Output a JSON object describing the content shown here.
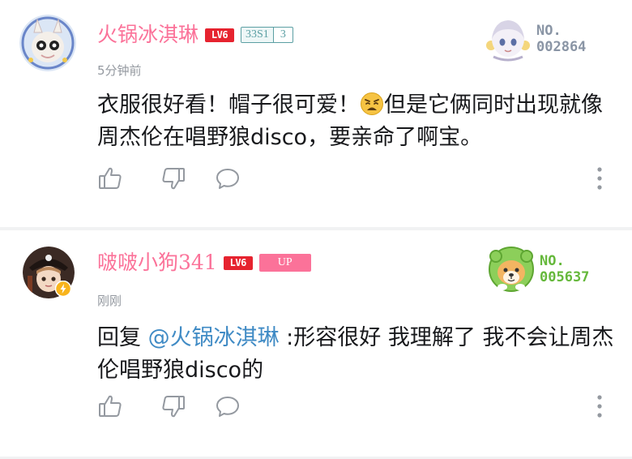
{
  "comments": [
    {
      "username": "火锅冰淇琳",
      "level_badge": "LV6",
      "fan_medal": {
        "name": "33S1",
        "level": "3"
      },
      "time": "5分钟前",
      "content_part1": "衣服很好看！帽子很可爱！",
      "emoji": "weary-face-emoji",
      "content_part2": "但是它俩同时出现就像周杰伦在唱野狼disco，要亲命了啊宝。",
      "nft_label": "NO.",
      "nft_number": "002864",
      "nft_color": "#8a95a5"
    },
    {
      "username": "啵啵小狗341",
      "level_badge": "LV6",
      "up_badge": "UP",
      "time": "刚刚",
      "reply_prefix": "回复 ",
      "mention": "@火锅冰淇琳",
      "content": " :形容很好 我理解了 我不会让周杰伦唱野狼disco的",
      "nft_label": "NO.",
      "nft_number": "005637",
      "nft_color": "#65b83b"
    }
  ],
  "icons": {
    "like": "thumbs-up-icon",
    "dislike": "thumbs-down-icon",
    "reply": "comment-bubble-icon",
    "more": "more-vertical-icon"
  },
  "colors": {
    "username": "#fb7299",
    "level_badge": "#e6232f",
    "mention": "#408bc5",
    "time": "#9499a0",
    "icon": "#9499a0"
  }
}
